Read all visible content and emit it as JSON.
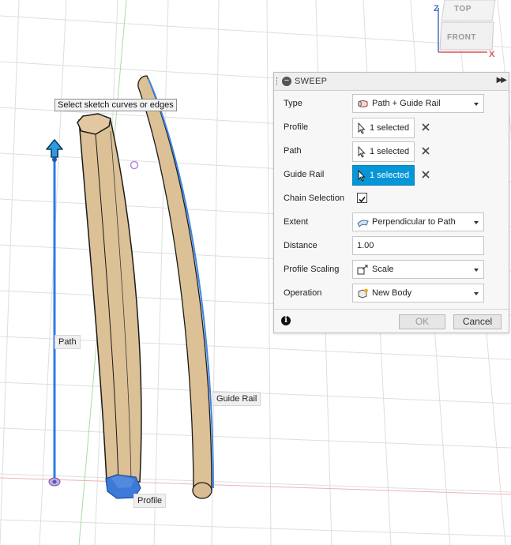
{
  "viewport": {
    "tooltip": "Select sketch curves or edges",
    "labels": {
      "path": "Path",
      "guide_rail": "Guide Rail",
      "profile": "Profile"
    },
    "viewcube": {
      "top": "TOP",
      "front": "FRONT",
      "axis_z": "Z",
      "axis_x": "X"
    },
    "colors": {
      "body": "#dcc096",
      "selection": "#2c7be5",
      "grid": "#dcdcdc",
      "axis_green": "#8fd28f",
      "axis_red": "#e8a2a2"
    },
    "icons": [
      "move-arrow-icon",
      "origin-point-icon"
    ]
  },
  "dialog": {
    "title": "SWEEP",
    "fields": {
      "type": {
        "label": "Type",
        "value": "Path + Guide Rail",
        "icon": "path-guide-rail-icon"
      },
      "profile": {
        "label": "Profile",
        "value": "1 selected",
        "icon": "cursor-arrow-icon"
      },
      "path": {
        "label": "Path",
        "value": "1 selected",
        "icon": "cursor-arrow-icon"
      },
      "guide_rail": {
        "label": "Guide Rail",
        "value": "1 selected",
        "icon": "cursor-arrow-icon"
      },
      "chain_selection": {
        "label": "Chain Selection",
        "checked": true
      },
      "extent": {
        "label": "Extent",
        "value": "Perpendicular to Path",
        "icon": "perpendicular-icon"
      },
      "distance": {
        "label": "Distance",
        "value": "1.00"
      },
      "profile_scaling": {
        "label": "Profile Scaling",
        "value": "Scale",
        "icon": "scale-icon"
      },
      "operation": {
        "label": "Operation",
        "value": "New Body",
        "icon": "new-body-icon"
      }
    },
    "buttons": {
      "ok": "OK",
      "cancel": "Cancel"
    },
    "accent": "#0696d7"
  }
}
